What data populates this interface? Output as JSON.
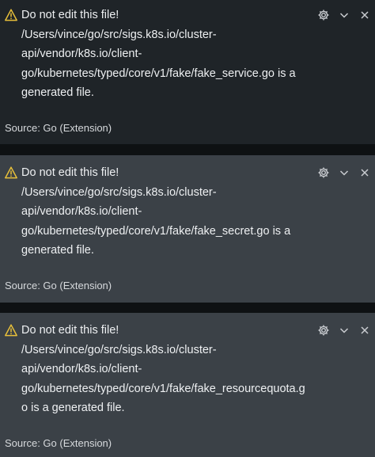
{
  "notifications": [
    {
      "severity_icon": "warning-icon",
      "title": "Do not edit this file!",
      "body": "/Users/vince/go/src/sigs.k8s.io/cluster-\napi/vendor/k8s.io/client-\ngo/kubernetes/typed/core/v1/fake/fake_service.go is a\ngenerated file.",
      "source": "Source: Go (Extension)",
      "actions": [
        "gear-icon",
        "chevron-down-icon",
        "close-icon"
      ]
    },
    {
      "severity_icon": "warning-icon",
      "title": "Do not edit this file!",
      "body": "/Users/vince/go/src/sigs.k8s.io/cluster-\napi/vendor/k8s.io/client-\ngo/kubernetes/typed/core/v1/fake/fake_secret.go is a\ngenerated file.",
      "source": "Source: Go (Extension)",
      "actions": [
        "gear-icon",
        "chevron-down-icon",
        "close-icon"
      ]
    },
    {
      "severity_icon": "warning-icon",
      "title": "Do not edit this file!",
      "body": "/Users/vince/go/src/sigs.k8s.io/cluster-\napi/vendor/k8s.io/client-\ngo/kubernetes/typed/core/v1/fake/fake_resourcequota.g\no is a generated file.",
      "source": "Source: Go (Extension)",
      "actions": [
        "gear-icon",
        "chevron-down-icon",
        "close-icon"
      ]
    }
  ],
  "colors": {
    "warning": "#e8c03a",
    "toast_dark": "#1f2428",
    "toast_light": "#3b4147",
    "text": "#eef0f2"
  }
}
